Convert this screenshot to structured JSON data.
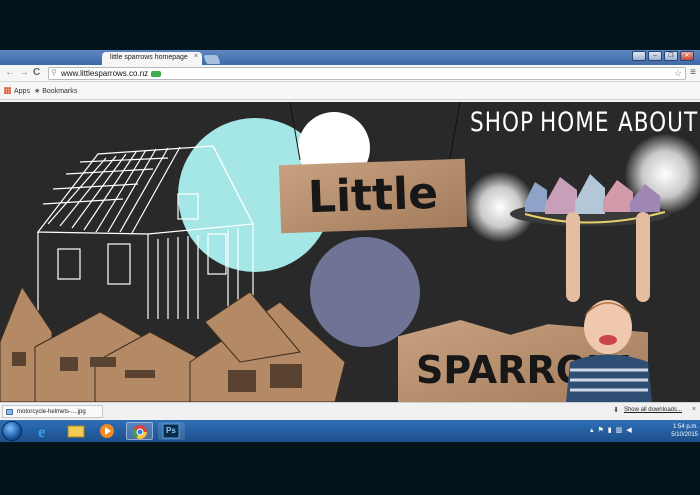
{
  "browser": {
    "tab_title": "little sparrows homepage",
    "tab_close": "×",
    "url": "www.littlesparrows.co.nz",
    "nav_back": "←",
    "nav_forward": "→",
    "nav_reload": "C",
    "omnibox_icon": "search-icon",
    "star_glyph": "☆",
    "menu_glyph": "≡",
    "bookmarks": [
      {
        "label": "Apps",
        "icon": "apps-icon"
      },
      {
        "label": "Bookmarks",
        "icon": "star-icon"
      }
    ],
    "window_controls": [
      "minimize",
      "restore",
      "close"
    ]
  },
  "site": {
    "nav": [
      "SHOP",
      "HOME",
      "ABOUT"
    ],
    "sign_top": "Little",
    "sign_bottom": "SPARROW"
  },
  "downloads": {
    "item": "motorcycle-helmets-....jpg",
    "show_all": "Show all downloads...",
    "close": "×"
  },
  "taskbar": {
    "time": "1:54 p.m.",
    "date": "5/10/2015",
    "apps": [
      "internet-explorer",
      "file-explorer",
      "media-player",
      "chrome",
      "photoshop"
    ],
    "photoshop_label": "Ps"
  },
  "colors": {
    "page_bg": "#292929",
    "cyan_circle": "#a5e6e6",
    "slate_circle": "#6f7396",
    "cardboard": "#b8916e"
  }
}
